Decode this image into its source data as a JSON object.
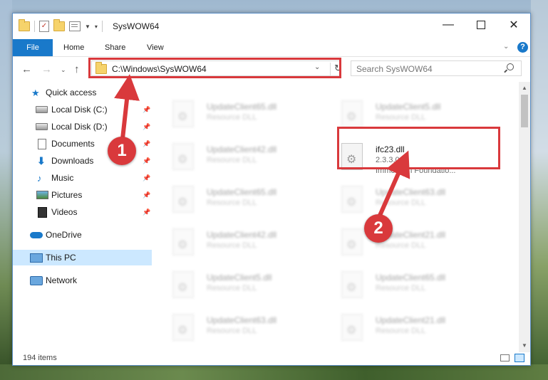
{
  "window": {
    "title": "SysWOW64",
    "controls": {
      "minimize": "—",
      "maximize": "",
      "close": "✕"
    }
  },
  "ribbon": {
    "tabs": [
      "File",
      "Home",
      "Share",
      "View"
    ],
    "help": "?"
  },
  "navbar": {
    "address": "C:\\Windows\\SysWOW64",
    "search_placeholder": "Search SysWOW64"
  },
  "navpane": {
    "items": [
      {
        "label": "Quick access",
        "icon": "star-icon"
      },
      {
        "label": "Local Disk (C:)",
        "icon": "disk-icon",
        "pinned": true
      },
      {
        "label": "Local Disk (D:)",
        "icon": "disk-icon",
        "pinned": true
      },
      {
        "label": "Documents",
        "icon": "documents-icon",
        "pinned": true
      },
      {
        "label": "Downloads",
        "icon": "downloads-icon",
        "pinned": true
      },
      {
        "label": "Music",
        "icon": "music-icon",
        "pinned": true
      },
      {
        "label": "Pictures",
        "icon": "pictures-icon",
        "pinned": true
      },
      {
        "label": "Videos",
        "icon": "videos-icon",
        "pinned": true
      },
      {
        "label": "OneDrive",
        "icon": "onedrive-icon"
      },
      {
        "label": "This PC",
        "icon": "pc-icon",
        "selected": true
      },
      {
        "label": "Network",
        "icon": "network-icon"
      }
    ]
  },
  "files": {
    "left": [
      {
        "name": "UpdateClient65.dll",
        "type": "Resource DLL"
      },
      {
        "name": "UpdateClient42.dll",
        "type": "Resource DLL"
      },
      {
        "name": "UpdateClient65.dll",
        "type": "Resource DLL"
      },
      {
        "name": "UpdateClient42.dll",
        "type": "Resource DLL"
      },
      {
        "name": "UpdateClient5.dll",
        "type": "Resource DLL"
      },
      {
        "name": "UpdateClient63.dll",
        "type": "Resource DLL"
      }
    ],
    "right": [
      {
        "name": "UpdateClient5.dll",
        "type": "Resource DLL"
      },
      {
        "name": "UpdateClient63.dll",
        "type": "Resource DLL"
      },
      {
        "name": "UpdateClient21.dll",
        "type": "Resource DLL"
      },
      {
        "name": "UpdateClient65.dll",
        "type": "Resource DLL"
      },
      {
        "name": "UpdateClient21.dll",
        "type": "Resource DLL"
      }
    ],
    "highlighted": {
      "name": "ifc23.dll",
      "version": "2.3.3.0",
      "description": "Immersion Foundatio..."
    }
  },
  "status": {
    "item_count": "194 items"
  },
  "annotations": {
    "badge_1": "1",
    "badge_2": "2",
    "color": "#d9393c"
  }
}
